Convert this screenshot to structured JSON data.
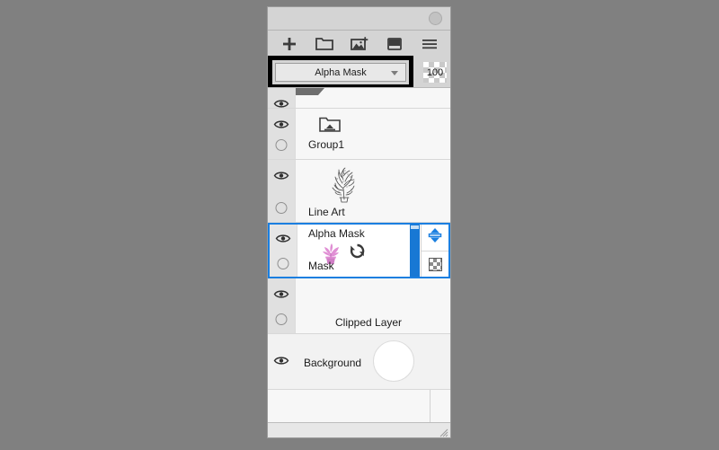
{
  "panel": {
    "title_circle": "panel-menu-circle",
    "toolbar": [
      {
        "name": "add-layer-icon",
        "label": "Add Layer"
      },
      {
        "name": "add-folder-icon",
        "label": "Add Folder"
      },
      {
        "name": "import-image-icon",
        "label": "Import Image"
      },
      {
        "name": "add-mask-icon",
        "label": "Add Mask"
      },
      {
        "name": "menu-hamburger-icon",
        "label": "Menu"
      }
    ],
    "mode": {
      "selected": "Alpha Mask",
      "caret": "chevron-down-icon",
      "highlight_color": "#000000"
    },
    "opacity": {
      "value": "100"
    }
  },
  "layers": [
    {
      "id": "partial",
      "name": "",
      "sub": "",
      "visible": true,
      "locked": false,
      "selected": false
    },
    {
      "id": "group",
      "name": "Group1",
      "sub": "",
      "visible": true,
      "locked": false,
      "selected": false,
      "thumb": "folder-icon"
    },
    {
      "id": "lineart",
      "name": "Line Art",
      "sub": "",
      "visible": true,
      "locked": false,
      "selected": false,
      "thumb": "line-art-sketch"
    },
    {
      "id": "alpha",
      "name": "Alpha Mask",
      "sub": "Mask",
      "visible": true,
      "locked": false,
      "selected": true,
      "thumb": "plant-thumbnail",
      "link_icon": "refresh-link-icon",
      "scrollbar_color": "#1878d4"
    },
    {
      "id": "clipped",
      "name": "Clipped Layer",
      "sub": "",
      "visible": true,
      "locked": false,
      "selected": false
    },
    {
      "id": "background",
      "name": "Background",
      "sub": "",
      "visible": true,
      "locked": false,
      "selected": false,
      "thumb": "white-circle"
    }
  ],
  "row_controls": {
    "move_updown": "up-down-arrows-icon",
    "transparency": "checkerboard-icon"
  },
  "footer": {
    "resize_grip": "resize-grip-icon"
  },
  "colors": {
    "selection_border": "#1b7fe0",
    "scrollbar": "#1878d4",
    "panel_bg": "#d4d4d4",
    "list_bg": "#f7f7f7",
    "gutter_bg": "#e0e0e0",
    "plant": "#e08fd4"
  }
}
